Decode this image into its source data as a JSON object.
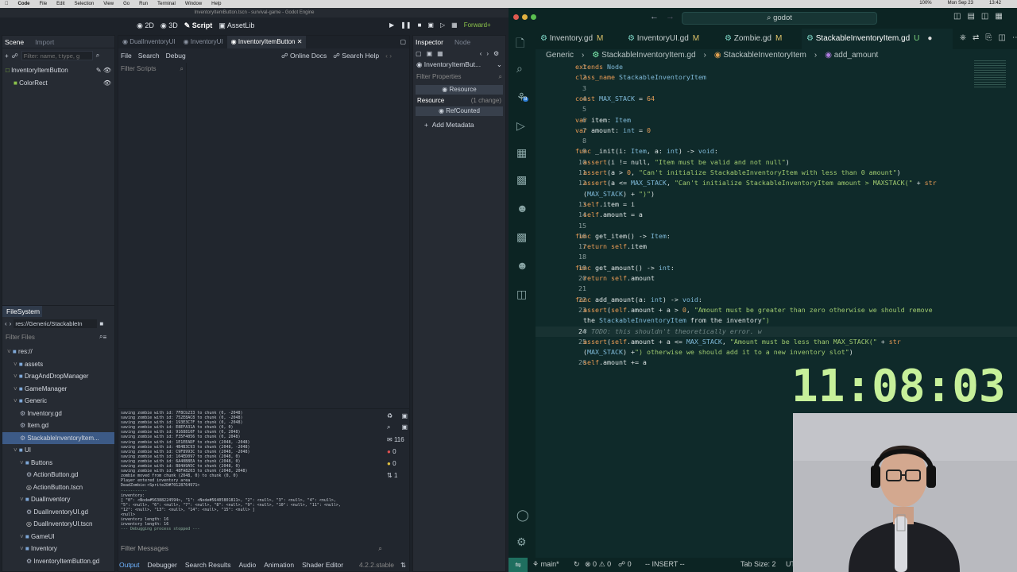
{
  "mac_menu": [
    "Code",
    "File",
    "Edit",
    "Selection",
    "View",
    "Go",
    "Run",
    "Terminal",
    "Window",
    "Help"
  ],
  "mac_status": {
    "battery": "100%",
    "date": "Mon Sep 23",
    "time": "13:42"
  },
  "godot": {
    "window_title": "InventoryItemButton.tscn - survival-game - Godot Engine",
    "workspaces": [
      "2D",
      "3D",
      "Script",
      "AssetLib"
    ],
    "run_label": "Forward+",
    "scene_tabs": [
      "Scene",
      "Import"
    ],
    "filter_placeholder": "Filter: name, t:type, g",
    "scene_tree": [
      "InventoryItemButton",
      "ColorRect"
    ],
    "editor_tabs": [
      "DualInventoryUI",
      "InventoryUI",
      "InventoryItemButton"
    ],
    "script_menu": [
      "File",
      "Search",
      "Debug"
    ],
    "online_docs": "Online Docs",
    "search_help": "Search Help",
    "filter_scripts": "Filter Scripts",
    "inspector_tabs": [
      "Inspector",
      "Node"
    ],
    "inspector_object": "InventoryItemBut...",
    "filter_properties": "Filter Properties",
    "resource_section": "Resource",
    "resource_label": "Resource",
    "resource_change": "(1 change)",
    "refcounted": "RefCounted",
    "add_metadata": "Add Metadata",
    "filesystem_title": "FileSystem",
    "fs_path": "res://Generic/StackableIn",
    "filter_files": "Filter Files",
    "fs_tree": [
      {
        "label": "res://",
        "depth": 0,
        "kind": "folder"
      },
      {
        "label": "assets",
        "depth": 1,
        "kind": "folder"
      },
      {
        "label": "DragAndDropManager",
        "depth": 1,
        "kind": "folder"
      },
      {
        "label": "GameManager",
        "depth": 1,
        "kind": "folder"
      },
      {
        "label": "Generic",
        "depth": 1,
        "kind": "folder"
      },
      {
        "label": "Inventory.gd",
        "depth": 2,
        "kind": "script"
      },
      {
        "label": "Item.gd",
        "depth": 2,
        "kind": "script"
      },
      {
        "label": "StackableInventoryItem...",
        "depth": 2,
        "kind": "script",
        "selected": true
      },
      {
        "label": "UI",
        "depth": 1,
        "kind": "folder"
      },
      {
        "label": "Buttons",
        "depth": 2,
        "kind": "folder"
      },
      {
        "label": "ActionButton.gd",
        "depth": 3,
        "kind": "script"
      },
      {
        "label": "ActionButton.tscn",
        "depth": 3,
        "kind": "scene"
      },
      {
        "label": "DualInventory",
        "depth": 2,
        "kind": "folder"
      },
      {
        "label": "DualInventoryUI.gd",
        "depth": 3,
        "kind": "script"
      },
      {
        "label": "DualInventoryUI.tscn",
        "depth": 3,
        "kind": "scene"
      },
      {
        "label": "GameUI",
        "depth": 2,
        "kind": "folder"
      },
      {
        "label": "Inventory",
        "depth": 2,
        "kind": "folder"
      },
      {
        "label": "InventoryItemButton.gd",
        "depth": 3,
        "kind": "script"
      }
    ],
    "console_lines": [
      "saving zombie with id: 7F8Cb233 to chunk (0, -2048)",
      "saving zombie with id: 752E8AC8 to chunk (0, -2048)",
      "saving zombie with id: 193E3C7F to chunk (0, -2048)",
      "saving zombie with id: E8EFA31A to chunk (0, 0)",
      "saving zombie with id: 9168810F to chunk (0, 2048)",
      "saving zombie with id: F35F4056 to chunk (0, 2048)",
      "saving zombie with id: 1E1EEADF to chunk (2048, -2048)",
      "saving zombie with id: 4B4B3C93 to chunk (2048, -2048)",
      "saving zombie with id: C9F8993C to chunk (2048, -2048)",
      "saving zombie with id: 104ED097 to chunk (2048, 0)",
      "saving zombie with id: 6A40B8EA to chunk (2048, 0)",
      "saving zombie with id: B84A9A5C to chunk (2048, 0)",
      "saving zombie with id: 48FA8203 to chunk (2048, 2048)",
      "zombie moved from chunk (2048, 0) to chunk (0, 0)",
      "Player entered inventory area",
      "DeadZombie:<Sprite2D#70128764971>",
      "-----------",
      "inventory:",
      "[ \"0\": <Node#56388224594>, \"1\": <Node#56405801811>, \"2\": <null>, \"3\": <null>, \"4\": <null>,",
      "\"5\": <null>, \"6\": <null>, \"7\": <null>, \"8\": <null>, \"9\": <null>, \"10\": <null>, \"11\": <null>,",
      "\"12\": <null>, \"13\": <null>, \"14\": <null>, \"15\": <null> ]",
      "<null>",
      "inventory length: 16",
      "inventory length: 16",
      "--- Debugging process stopped ---"
    ],
    "console_counts": [
      "116",
      "0",
      "0",
      "1"
    ],
    "filter_messages": "Filter Messages",
    "bottom_tabs": [
      "Output",
      "Debugger",
      "Search Results",
      "Audio",
      "Animation",
      "Shader Editor"
    ],
    "version": "4.2.2.stable"
  },
  "vscode": {
    "search": "godot",
    "tabs": [
      {
        "label": "Inventory.gd",
        "status": "M"
      },
      {
        "label": "InventoryUI.gd",
        "status": "M"
      },
      {
        "label": "Zombie.gd",
        "status": "M"
      },
      {
        "label": "StackableInventoryItem.gd",
        "status": "U",
        "active": true
      }
    ],
    "breadcrumb": [
      "Generic",
      "StackableInventoryItem.gd",
      "StackableInventoryItem",
      "add_amount"
    ],
    "code": [
      {
        "n": "1",
        "t": "extends Node"
      },
      {
        "n": "2",
        "t": "class_name StackableInventoryItem"
      },
      {
        "n": "3",
        "t": ""
      },
      {
        "n": "4",
        "t": "const MAX_STACK = 64"
      },
      {
        "n": "5",
        "t": ""
      },
      {
        "n": "6",
        "t": "var item: Item"
      },
      {
        "n": "7",
        "t": "var amount: int = 0"
      },
      {
        "n": "8",
        "t": ""
      },
      {
        "n": "9",
        "t": "func _init(i: Item, a: int) -> void:"
      },
      {
        "n": "10",
        "t": "  assert(i != null, \"Item must be valid and not null\")"
      },
      {
        "n": "11",
        "t": "  assert(a > 0, \"Can't initialize StackableInventoryItem with less than 0 amount\")"
      },
      {
        "n": "12",
        "t": "  assert(a <= MAX_STACK, \"Can't initialize StackableInventoryItem amount > MAXSTACK(\" + str"
      },
      {
        "n": "",
        "t": "  (MAX_STACK) + \")\")"
      },
      {
        "n": "13",
        "t": "  self.item = i"
      },
      {
        "n": "14",
        "t": "  self.amount = a"
      },
      {
        "n": "15",
        "t": ""
      },
      {
        "n": "16",
        "t": "func get_item() -> Item:"
      },
      {
        "n": "17",
        "t": "  return self.item"
      },
      {
        "n": "18",
        "t": ""
      },
      {
        "n": "19",
        "t": "func get_amount() -> int:"
      },
      {
        "n": "20",
        "t": "  return self.amount"
      },
      {
        "n": "21",
        "t": ""
      },
      {
        "n": "22",
        "t": "func add_amount(a: int) -> void:"
      },
      {
        "n": "23",
        "t": "  assert(self.amount + a > 0, \"Amount must be greater than zero otherwise we should remove"
      },
      {
        "n": "",
        "t": "  the StackableInventoryItem from the inventory\")"
      },
      {
        "n": "24",
        "t": "  # TODO: this shouldn't theoretically error. w"
      },
      {
        "n": "25",
        "t": "  assert(self.amount + a <= MAX_STACK, \"Amount must be less than MAX_STACK(\" + str"
      },
      {
        "n": "",
        "t": "  (MAX_STACK) +\") otherwise we should add it to a new inventory slot\")"
      },
      {
        "n": "26",
        "t": "  self.amount += a"
      }
    ],
    "status": {
      "branch": "main*",
      "errors": "0",
      "warnings": "0",
      "mode": "-- INSERT --",
      "tab": "Tab Size: 2",
      "enc": "UT"
    },
    "clock": "11:08:03"
  },
  "colors": {
    "godot_bg": "#1d2229",
    "vscode_bg": "#0f2a2a",
    "clock": "#c7f09a",
    "selection": "#3c5a86"
  }
}
